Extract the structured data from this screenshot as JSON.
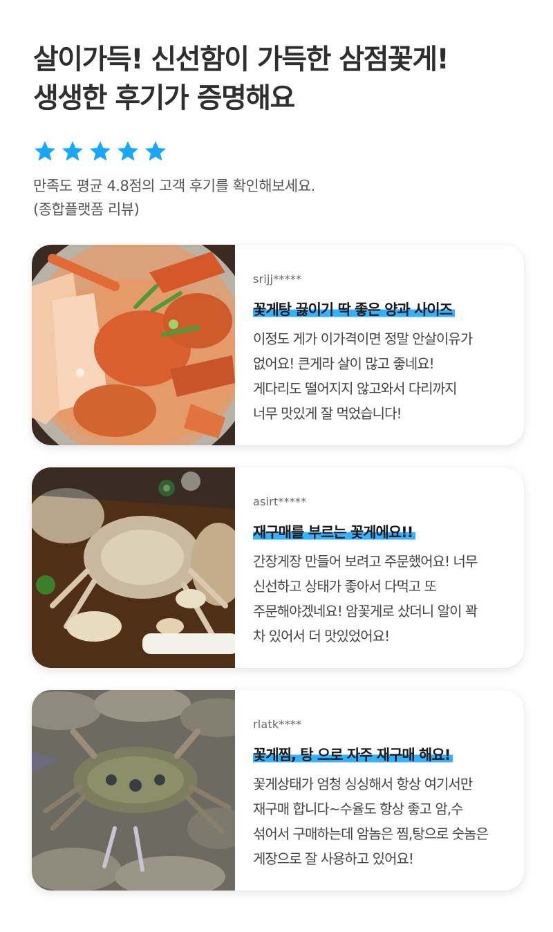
{
  "headline": {
    "line1": "살이가득! 신선함이 가득한 삼점꽃게!",
    "line2": "생생한 후기가 증명해요"
  },
  "rating": {
    "stars": 5,
    "color": "#18a7ff"
  },
  "summary": {
    "line1": "만족도 평균 4.8점의 고객 후기를 확인해보세요.",
    "line2": "(종합플랫폼 리뷰)"
  },
  "highlight_color": "#34b1ff",
  "reviews": [
    {
      "user": "srijj*****",
      "title": "꽃게탕 끓이기 딱 좋은 양과 사이즈",
      "lines": [
        "이정도 게가 이가격이면 정말 안살이유가",
        "없어요!  큰게라 살이 많고 좋네요!",
        "게다리도 떨어지지 않고와서 다리까지",
        "너무 맛있게 잘 먹었습니다!"
      ],
      "photo_icon": "crab-stew-photo"
    },
    {
      "user": "asirt*****",
      "title": "재구매를 부르는 꽃게에요!!",
      "lines": [
        "간장게장 만들어 보려고 주문했어요! 너무",
        "신선하고 상태가 좋아서 다먹고 또",
        "주문해야겠네요! 암꽃게로 샀더니 알이 꽉",
        "차 있어서 더 맛있었어요!"
      ],
      "photo_icon": "soy-marinated-crab-photo"
    },
    {
      "user": "rlatk****",
      "title": "꽃게찜, 탕 으로 자주 재구매 해요!",
      "lines": [
        "꽃게상태가 엄청 싱싱해서 항상 여기서만",
        "재구매 합니다~수율도 항상 좋고 암,수",
        "섞어서 구매하는데 암놈은 찜,탕으로 숫놈은",
        "게장으로 잘 사용하고 있어요!"
      ],
      "photo_icon": "raw-crabs-photo"
    }
  ]
}
